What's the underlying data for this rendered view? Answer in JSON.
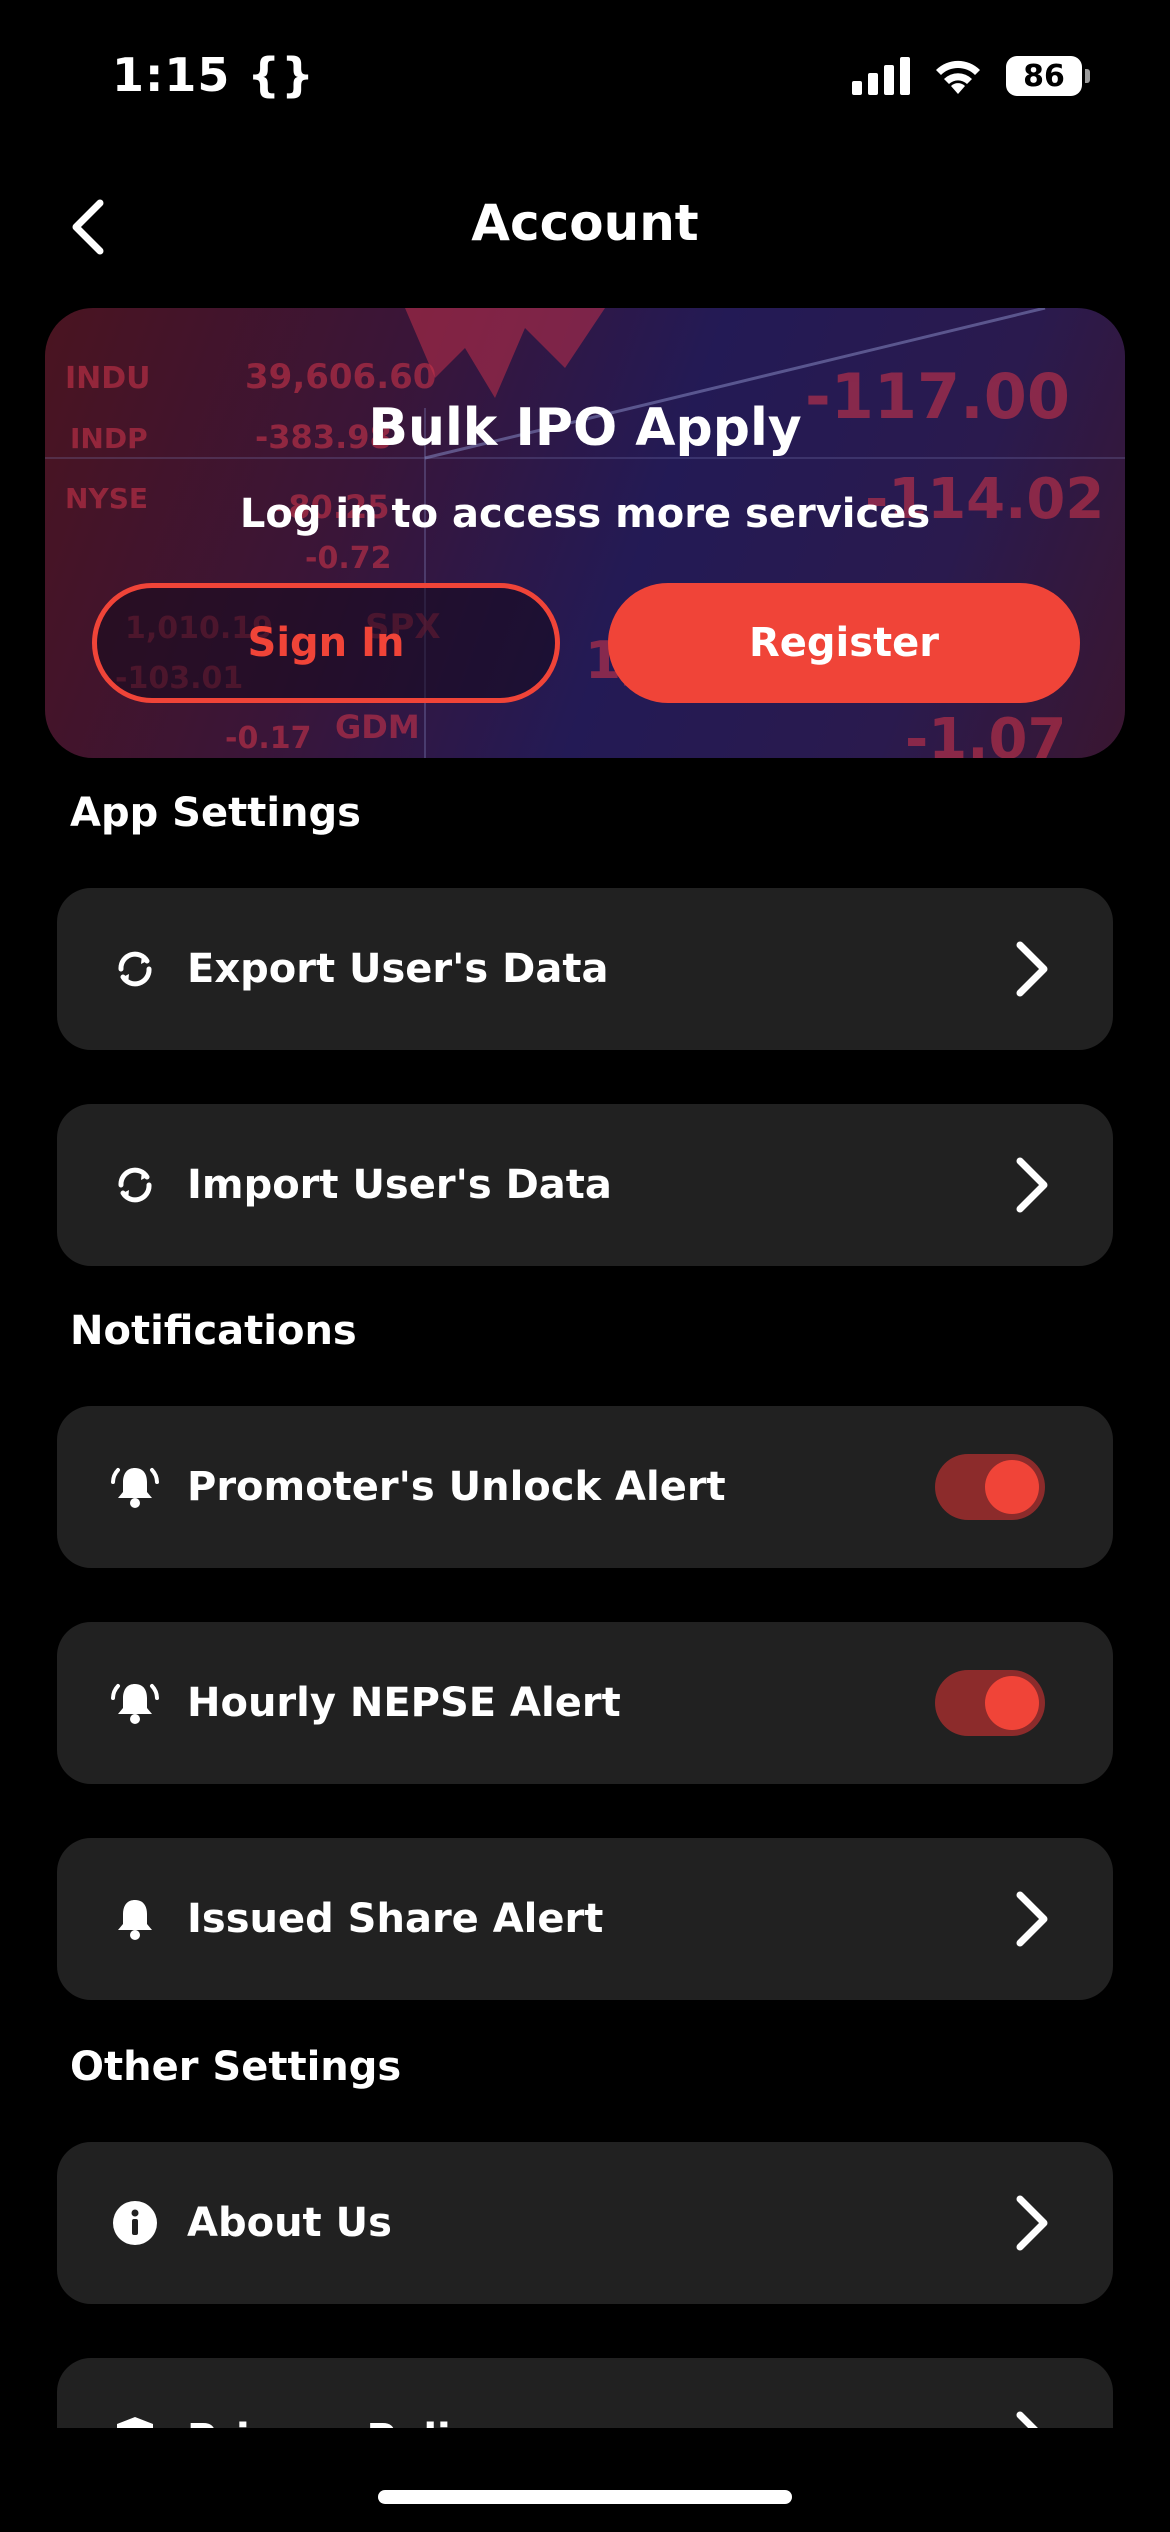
{
  "status_bar": {
    "time": "1:15 {}",
    "battery": "86"
  },
  "header": {
    "title": "Account"
  },
  "banner": {
    "title": "Bulk IPO Apply",
    "subtitle": "Log in to access more services",
    "sign_in": "Sign In",
    "register": "Register"
  },
  "sections": {
    "app_settings": "App Settings",
    "notifications": "Notifications",
    "other_settings": "Other Settings"
  },
  "rows": {
    "export": {
      "label": "Export User's Data",
      "icon": "sync-icon"
    },
    "import": {
      "label": "Import User's Data",
      "icon": "sync-icon"
    },
    "promoter_unlock": {
      "label": "Promoter's Unlock Alert",
      "icon": "bell-ring-icon",
      "toggle": true
    },
    "hourly_nepse": {
      "label": "Hourly NEPSE Alert",
      "icon": "bell-ring-icon",
      "toggle": true
    },
    "issued_share": {
      "label": "Issued Share Alert",
      "icon": "bell-icon"
    },
    "about_us": {
      "label": "About Us",
      "icon": "info-icon"
    },
    "privacy_policy": {
      "label": "Privacy Policy",
      "icon": "shield-icon"
    }
  },
  "colors": {
    "accent": "#f04438",
    "row_bg": "#212121",
    "toggle_track": "#8c2b2b"
  }
}
